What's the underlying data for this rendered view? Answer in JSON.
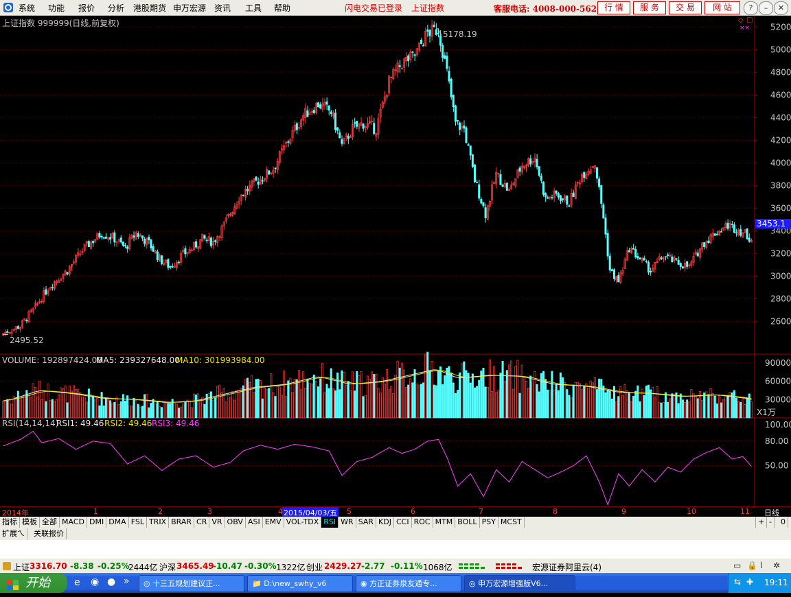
{
  "menu": {
    "items": [
      "系统",
      "功能",
      "报价",
      "分析",
      "港股期货",
      "申万宏源",
      "资讯",
      "工具",
      "帮助"
    ],
    "status_login": "闪电交易已登录",
    "status_index": "上证指数",
    "hotline": "客服电话: 4008-000-562",
    "nav_buttons": [
      "行 情",
      "服 务",
      "交 易",
      "网 站"
    ]
  },
  "colors": {
    "up": "#ff3c3c",
    "down": "#54ffff",
    "grid": "#6b0000",
    "axis_text": "#c8c8c8",
    "ma5": "#e8e8e8",
    "ma10": "#e6e600",
    "rsi": "#ff40ff",
    "price_tag_bg": "#1c1cff"
  },
  "kline": {
    "title": "上证指数 999999(日线,前复权)",
    "high_marker": "5178.19",
    "low_marker": "2495.52",
    "current_tag": "3453.1",
    "y_ticks": [
      "5200",
      "5000",
      "4800",
      "4600",
      "4400",
      "4200",
      "4000",
      "3800",
      "3600",
      "3400",
      "3200",
      "3000",
      "2800",
      "2600"
    ]
  },
  "volume": {
    "label_volume": "VOLUME: 192897424.00",
    "label_ma5": "MA5: 239327648.00",
    "label_ma10": "MA10: 301993984.00",
    "y_ticks": [
      "90000",
      "60000",
      "30000"
    ],
    "unit": "X1万"
  },
  "rsi": {
    "label_name": "RSI(14,14,14)",
    "label_rsi1": "RSI1: 49.46",
    "label_rsi2": "RSI2: 49.46",
    "label_rsi3": "RSI3: 49.46",
    "y_ticks": [
      "100.00",
      "80.00",
      "50.00"
    ]
  },
  "xaxis": {
    "year_label": "2014年",
    "months": [
      "1",
      "2",
      "3",
      "4",
      "5",
      "6",
      "7",
      "8",
      "9",
      "10",
      "11"
    ],
    "cursor_date": "2015/04/03/五",
    "period": "日线"
  },
  "tabs": {
    "items": [
      "指标",
      "模板",
      "全部",
      "MACD",
      "DMI",
      "DMA",
      "FSL",
      "TRIX",
      "BRAR",
      "CR",
      "VR",
      "OBV",
      "ASI",
      "EMV",
      "VOL-TDX",
      "RSI",
      "WR",
      "SAR",
      "KDJ",
      "CCI",
      "ROC",
      "MTM",
      "BOLL",
      "PSY",
      "MCST"
    ],
    "active": "RSI",
    "right_buttons": [
      "+",
      "-",
      "0"
    ]
  },
  "extra_tabs": [
    "扩展ㄟ",
    "关联报价"
  ],
  "quotes": [
    {
      "name": "上证",
      "price": "3316.70",
      "change": "-8.38",
      "pct": "-0.25%",
      "amount": "2444亿"
    },
    {
      "name": "沪深",
      "price": "3465.49",
      "change": "-10.47",
      "pct": "-0.30%",
      "amount": "1322亿"
    },
    {
      "name": "创业",
      "price": "2429.27",
      "change": "-2.77",
      "pct": "-0.11%",
      "amount": "1068亿"
    }
  ],
  "broker_label": "宏源证券阿里云(4)",
  "chart_data": {
    "type": "candlestick",
    "instrument": "上证指数 999999",
    "period": "日线",
    "ylim": [
      2450,
      5250
    ],
    "high": 5178.19,
    "low": 2495.52,
    "last": 3453.1,
    "anchors": [
      [
        0,
        2495
      ],
      [
        8,
        2560
      ],
      [
        14,
        2700
      ],
      [
        22,
        2920
      ],
      [
        30,
        3050
      ],
      [
        38,
        3250
      ],
      [
        46,
        3380
      ],
      [
        52,
        3330
      ],
      [
        57,
        3250
      ],
      [
        62,
        3380
      ],
      [
        68,
        3290
      ],
      [
        73,
        3150
      ],
      [
        78,
        3080
      ],
      [
        83,
        3180
      ],
      [
        88,
        3240
      ],
      [
        93,
        3330
      ],
      [
        98,
        3300
      ],
      [
        103,
        3450
      ],
      [
        110,
        3700
      ],
      [
        118,
        3830
      ],
      [
        126,
        3950
      ],
      [
        133,
        4200
      ],
      [
        140,
        4420
      ],
      [
        147,
        4520
      ],
      [
        153,
        4450
      ],
      [
        158,
        4150
      ],
      [
        163,
        4300
      ],
      [
        168,
        4350
      ],
      [
        174,
        4300
      ],
      [
        180,
        4720
      ],
      [
        186,
        4880
      ],
      [
        192,
        4950
      ],
      [
        198,
        5150
      ],
      [
        203,
        5178
      ],
      [
        207,
        4800
      ],
      [
        211,
        4350
      ],
      [
        215,
        4300
      ],
      [
        220,
        3850
      ],
      [
        225,
        3550
      ],
      [
        230,
        3900
      ],
      [
        236,
        3750
      ],
      [
        242,
        3980
      ],
      [
        248,
        4050
      ],
      [
        253,
        3680
      ],
      [
        258,
        3720
      ],
      [
        264,
        3650
      ],
      [
        270,
        3900
      ],
      [
        276,
        4000
      ],
      [
        280,
        3520
      ],
      [
        283,
        3050
      ],
      [
        287,
        2950
      ],
      [
        292,
        3250
      ],
      [
        297,
        3150
      ],
      [
        302,
        3050
      ],
      [
        308,
        3180
      ],
      [
        314,
        3120
      ],
      [
        320,
        3080
      ],
      [
        326,
        3280
      ],
      [
        332,
        3380
      ],
      [
        338,
        3450
      ],
      [
        344,
        3400
      ],
      [
        349,
        3330
      ]
    ],
    "volume_ylim": [
      0,
      100000
    ],
    "volume_unit": "X1万",
    "volume_anchors": [
      [
        0,
        28000
      ],
      [
        15,
        45000
      ],
      [
        30,
        40000
      ],
      [
        45,
        32000
      ],
      [
        60,
        30000
      ],
      [
        75,
        25000
      ],
      [
        88,
        28000
      ],
      [
        100,
        38000
      ],
      [
        115,
        50000
      ],
      [
        130,
        55000
      ],
      [
        145,
        68000
      ],
      [
        160,
        55000
      ],
      [
        175,
        60000
      ],
      [
        190,
        72000
      ],
      [
        200,
        80000
      ],
      [
        210,
        65000
      ],
      [
        225,
        70000
      ],
      [
        240,
        68000
      ],
      [
        255,
        55000
      ],
      [
        270,
        52000
      ],
      [
        285,
        42000
      ],
      [
        300,
        40000
      ],
      [
        315,
        35000
      ],
      [
        330,
        38000
      ],
      [
        345,
        32000
      ],
      [
        349,
        28000
      ]
    ],
    "rsi_ylim": [
      0,
      100
    ],
    "rsi_anchors": [
      [
        0,
        74
      ],
      [
        8,
        82
      ],
      [
        14,
        92
      ],
      [
        18,
        78
      ],
      [
        26,
        83
      ],
      [
        34,
        70
      ],
      [
        42,
        80
      ],
      [
        50,
        77
      ],
      [
        58,
        52
      ],
      [
        66,
        62
      ],
      [
        74,
        44
      ],
      [
        82,
        58
      ],
      [
        90,
        62
      ],
      [
        98,
        48
      ],
      [
        106,
        54
      ],
      [
        112,
        68
      ],
      [
        120,
        75
      ],
      [
        128,
        70
      ],
      [
        136,
        76
      ],
      [
        144,
        73
      ],
      [
        152,
        68
      ],
      [
        158,
        38
      ],
      [
        165,
        55
      ],
      [
        172,
        60
      ],
      [
        180,
        72
      ],
      [
        186,
        65
      ],
      [
        192,
        70
      ],
      [
        198,
        80
      ],
      [
        203,
        82
      ],
      [
        207,
        60
      ],
      [
        212,
        25
      ],
      [
        218,
        40
      ],
      [
        224,
        12
      ],
      [
        230,
        45
      ],
      [
        236,
        30
      ],
      [
        242,
        55
      ],
      [
        248,
        45
      ],
      [
        254,
        35
      ],
      [
        260,
        42
      ],
      [
        266,
        50
      ],
      [
        272,
        62
      ],
      [
        278,
        30
      ],
      [
        282,
        2
      ],
      [
        287,
        40
      ],
      [
        292,
        25
      ],
      [
        298,
        45
      ],
      [
        304,
        30
      ],
      [
        310,
        48
      ],
      [
        316,
        42
      ],
      [
        322,
        58
      ],
      [
        328,
        66
      ],
      [
        334,
        72
      ],
      [
        340,
        58
      ],
      [
        345,
        61
      ],
      [
        349,
        49
      ]
    ]
  }
}
